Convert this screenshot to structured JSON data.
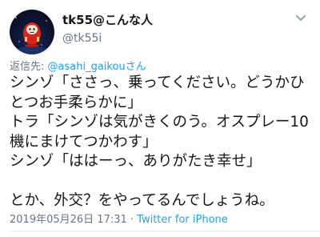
{
  "user": {
    "display_name": "tk55@こんな人",
    "handle": "@tk55i"
  },
  "reply": {
    "prefix": "返信先: ",
    "mention": "@asahi_gaikouさん"
  },
  "tweet_lines": [
    "シンゾ「ささっ、乗ってください。どうかひ",
    "とつお手柔らかに」",
    "トラ「シンゾは気がきくのう。オスプレー10",
    "機にまけてつかわす」",
    "シンゾ「ははーっ、ありがたき幸せ」",
    "",
    "とか、外交？をやってるんでしょうね。"
  ],
  "meta": {
    "datetime": "2019年05月26日 17:31",
    "separator": " · ",
    "source": "Twitter for iPhone"
  },
  "colors": {
    "link": "#1da1f2",
    "secondary_text": "#657786",
    "primary_text": "#14171a"
  },
  "icons": {
    "menu": "chevron-down-icon",
    "avatar": "daruma-avatar"
  }
}
